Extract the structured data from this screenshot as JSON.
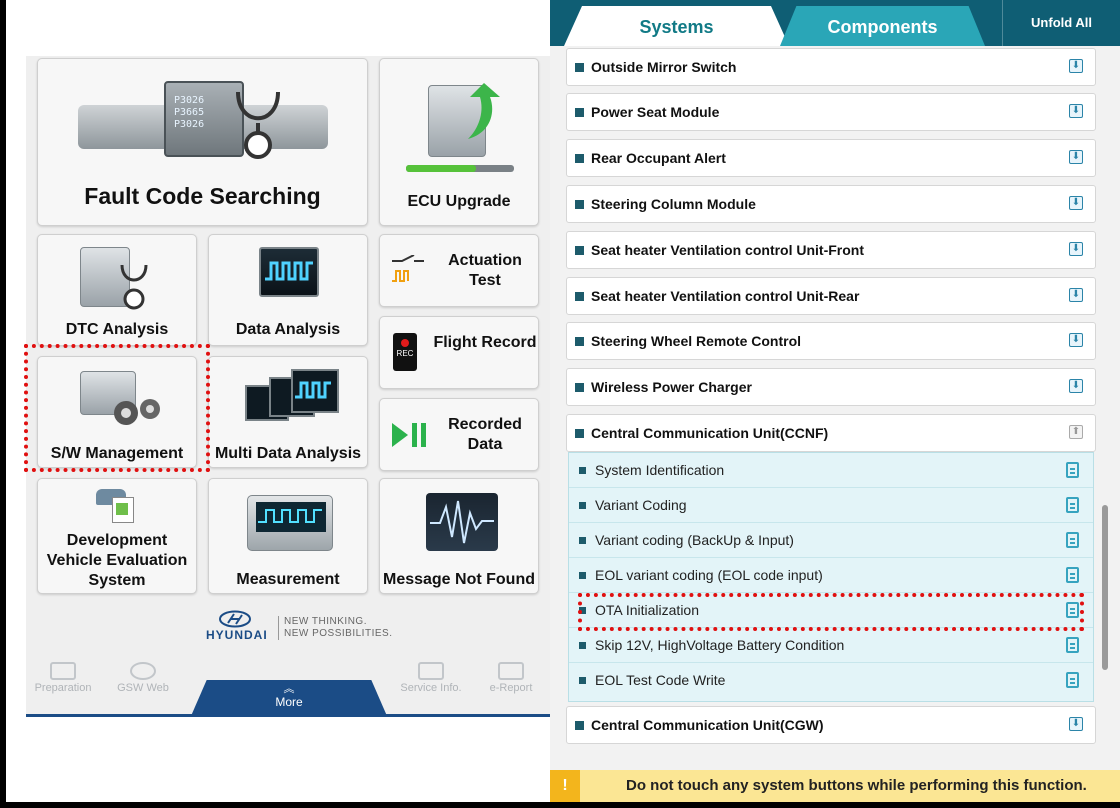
{
  "left": {
    "tiles": {
      "fault": "Fault Code Searching",
      "ecu_upgrade": "ECU Upgrade",
      "dtc": "DTC Analysis",
      "data": "Data Analysis",
      "actuation": "Actuation Test",
      "flight": "Flight Record",
      "sw": "S/W Management",
      "multi": "Multi Data Analysis",
      "recorded": "Recorded Data",
      "dev": "Development Vehicle Evaluation System",
      "measurement": "Measurement",
      "message": "Message Not Found"
    },
    "brand": {
      "name": "HYUNDAI",
      "line1": "NEW THINKING.",
      "line2": "NEW POSSIBILITIES."
    },
    "nav": {
      "preparation": "Preparation",
      "gsw_web": "GSW Web",
      "more": "More",
      "service_info": "Service Info.",
      "e_report": "e-Report"
    }
  },
  "right": {
    "tabs": {
      "systems": "Systems",
      "components": "Components",
      "unfold": "Unfold All"
    },
    "rows": [
      "Outside Mirror Switch",
      "Power Seat Module",
      "Rear Occupant Alert",
      "Steering Column Module",
      "Seat heater Ventilation control Unit-Front",
      "Seat heater Ventilation control Unit-Rear",
      "Steering Wheel Remote Control",
      "Wireless Power Charger",
      "Central Communication Unit(CCNF)"
    ],
    "subs": [
      "System Identification",
      "Variant Coding",
      "Variant coding (BackUp & Input)",
      "EOL variant coding (EOL code input)",
      "OTA Initialization",
      "Skip 12V, HighVoltage Battery Condition",
      "EOL Test Code Write"
    ],
    "last_row": "Central Communication Unit(CGW)",
    "warning": "Do not touch any system buttons while performing this function."
  }
}
